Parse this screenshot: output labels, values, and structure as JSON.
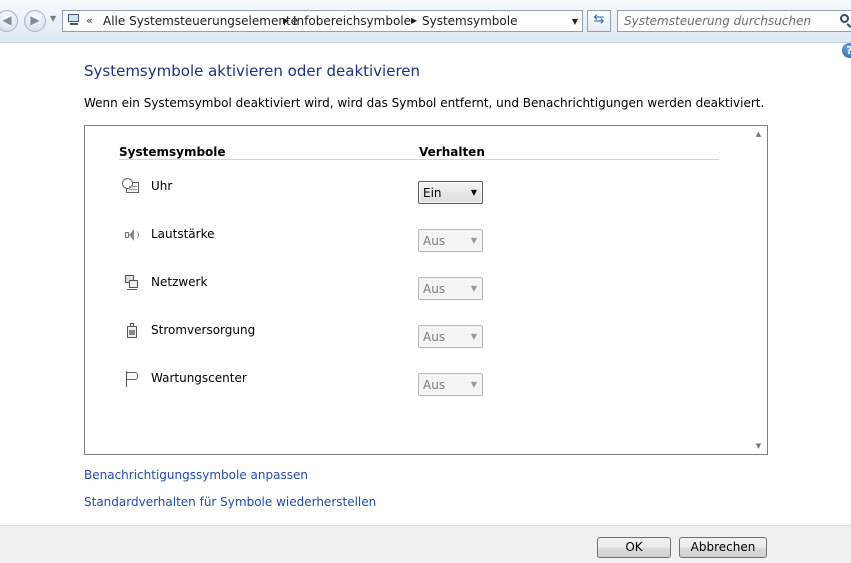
{
  "navigation": {
    "breadcrumb": [
      "Alle Systemsteuerungselemente",
      "Infobereichsymbole",
      "Systemsymbole"
    ],
    "search_placeholder": "Systemsteuerung durchsuchen"
  },
  "page": {
    "title": "Systemsymbole aktivieren oder deaktivieren",
    "description": "Wenn ein Systemsymbol deaktiviert wird, wird das Symbol entfernt, und Benachrichtigungen werden deaktiviert."
  },
  "table": {
    "headers": {
      "name": "Systemsymbole",
      "behavior": "Verhalten"
    },
    "rows": [
      {
        "label": "Uhr",
        "icon": "clock-icon",
        "value": "Ein",
        "enabled": true
      },
      {
        "label": "Lautstärke",
        "icon": "speaker-icon",
        "value": "Aus",
        "enabled": false
      },
      {
        "label": "Netzwerk",
        "icon": "network-icon",
        "value": "Aus",
        "enabled": false
      },
      {
        "label": "Stromversorgung",
        "icon": "battery-icon",
        "value": "Aus",
        "enabled": false
      },
      {
        "label": "Wartungscenter",
        "icon": "flag-icon",
        "value": "Aus",
        "enabled": false
      }
    ]
  },
  "links": {
    "customize": "Benachrichtigungssymbole anpassen",
    "restore": "Standardverhalten für Symbole wiederherstellen"
  },
  "buttons": {
    "ok": "OK",
    "cancel": "Abbrechen"
  }
}
